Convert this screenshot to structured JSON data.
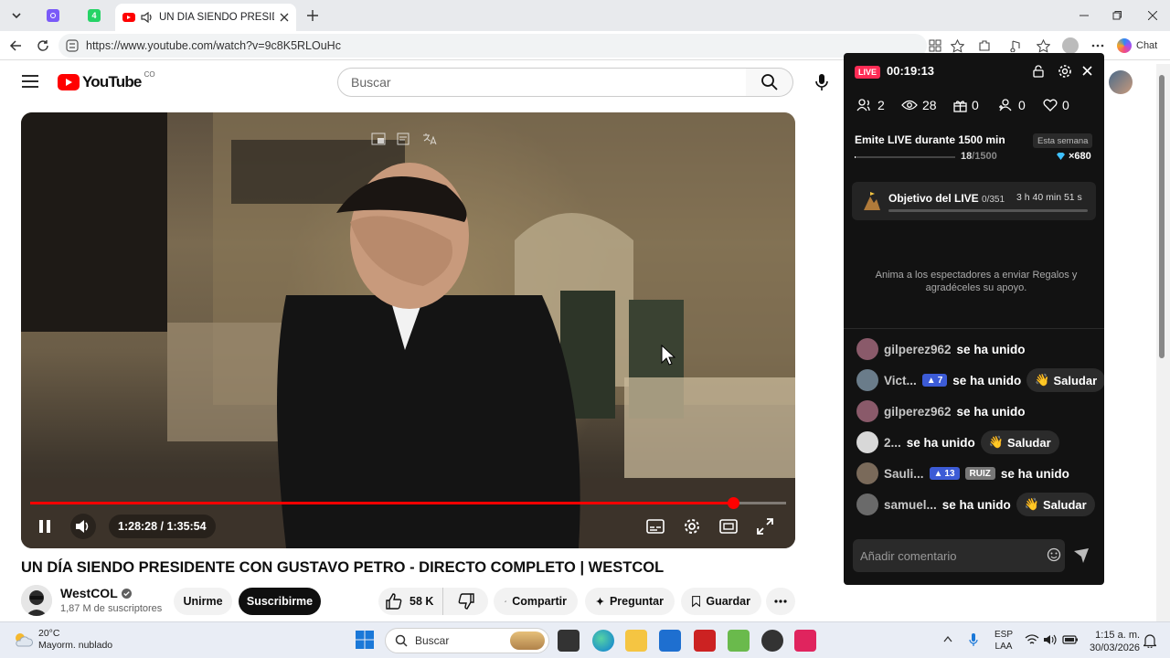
{
  "browser": {
    "tab_badge": "4",
    "active_tab_title": "UN DÍA SIENDO PRESIDENTE",
    "url": "https://www.youtube.com/watch?v=9c8K5RLOuHc",
    "chat_label": "Chat"
  },
  "youtube": {
    "logo_text": "YouTube",
    "country_code": "CO",
    "search_placeholder": "Buscar",
    "video": {
      "time": "1:28:28 / 1:35:54",
      "progress_fraction": 0.93,
      "title": "UN DÍA SIENDO PRESIDENTE CON GUSTAVO PETRO - DIRECTO COMPLETO | WESTCOL"
    },
    "channel": {
      "name": "WestCOL",
      "subscribers": "1,87 M de suscriptores",
      "join_label": "Unirme",
      "subscribe_label": "Suscribirme"
    },
    "actions": {
      "likes": "58 K",
      "share": "Compartir",
      "ask": "Preguntar",
      "save": "Guardar"
    }
  },
  "live_panel": {
    "badge": "LIVE",
    "timer": "00:19:13",
    "stats": {
      "participants": "2",
      "viewers": "28",
      "gifts": "0",
      "guests": "0",
      "likes": "0"
    },
    "mission": {
      "title": "Emite LIVE durante 1500 min",
      "period": "Esta semana",
      "progress_current": "18",
      "progress_total": "/1500",
      "progress_fraction": 0.012,
      "reward": "×680"
    },
    "goal": {
      "title": "Objetivo del LIVE",
      "count": "0/351",
      "time_left": "3 h 40 min 51 s",
      "progress_fraction": 0
    },
    "gift_prompt": "Anima a los espectadores a enviar Regalos y agradéceles su apoyo.",
    "chat": [
      {
        "user": "gilperez962",
        "action": "se ha unido",
        "level": "",
        "badge": "",
        "greet": "",
        "color": "#8a5a6a"
      },
      {
        "user": "Vict...",
        "action": "se ha unido",
        "level": "7",
        "badge": "",
        "greet": "Saludar",
        "color": "#6a7c8a"
      },
      {
        "user": "gilperez962",
        "action": "se ha unido",
        "level": "",
        "badge": "",
        "greet": "",
        "color": "#8a5a6a"
      },
      {
        "user": "2...",
        "action": "se ha unido",
        "level": "",
        "badge": "",
        "greet": "Saludar",
        "color": "#d8d8d8"
      },
      {
        "user": "Sauli...",
        "action": "se ha unido",
        "level": "13",
        "badge": "RUIZ",
        "greet": "",
        "color": "#7a6a5a"
      },
      {
        "user": "samuel...",
        "action": "se ha unido",
        "level": "",
        "badge": "",
        "greet": "Saludar",
        "color": "#6a6a6a"
      }
    ],
    "comment_placeholder": "Añadir comentario"
  },
  "taskbar": {
    "temperature": "20°C",
    "weather": "Mayorm. nublado",
    "search_placeholder": "Buscar",
    "lang_top": "ESP",
    "lang_bottom": "LAA",
    "time": "1:15 a. m.",
    "date": "30/03/2026"
  }
}
